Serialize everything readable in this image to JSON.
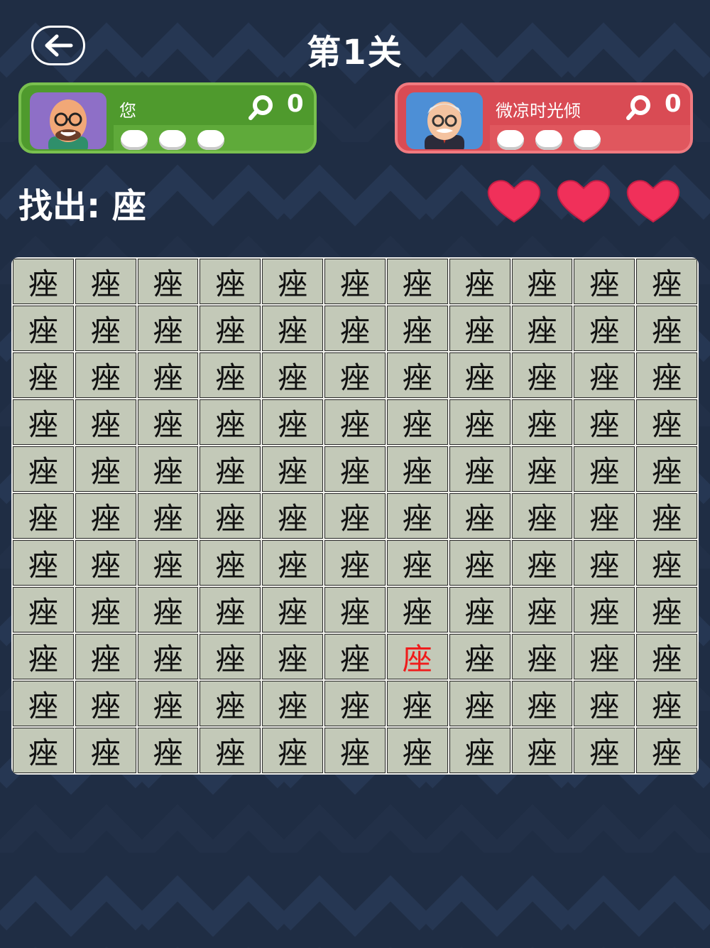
{
  "header": {
    "title": "第1关"
  },
  "player": {
    "name": "您",
    "score": "0",
    "slots": 3
  },
  "opponent": {
    "name": "微凉时光倾",
    "score": "0",
    "slots": 3
  },
  "task": {
    "label": "找出:",
    "target": "座"
  },
  "lives": 3,
  "board": {
    "rows": 11,
    "cols": 11,
    "distractor_char": "痤",
    "target_char": "座",
    "target_row": 9,
    "target_col": 7
  },
  "colors": {
    "player_green": "#5faa3a",
    "opponent_red": "#e0575e",
    "heart": "#f0305a",
    "target_text": "#ef1c1c",
    "cell_bg": "#c3c9b8"
  }
}
